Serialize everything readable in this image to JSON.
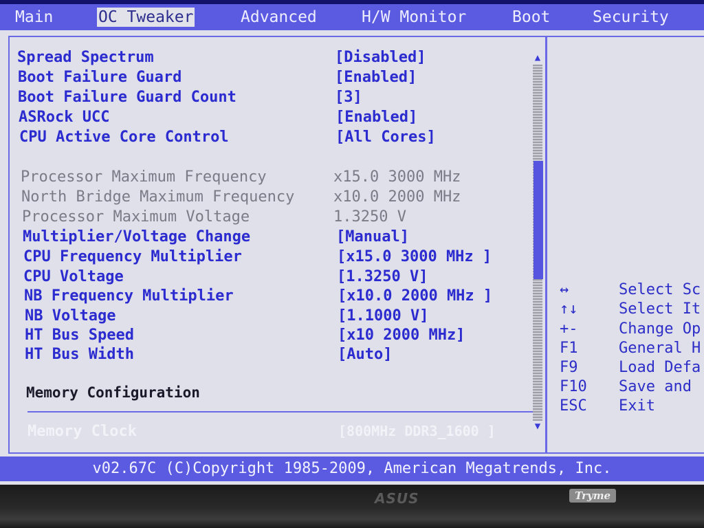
{
  "menu": {
    "tabs": [
      {
        "label": "Main",
        "active": false
      },
      {
        "label": "OC Tweaker",
        "active": true
      },
      {
        "label": "Advanced",
        "active": false
      },
      {
        "label": "H/W Monitor",
        "active": false
      },
      {
        "label": "Boot",
        "active": false
      },
      {
        "label": "Security",
        "active": false
      }
    ]
  },
  "settings": [
    {
      "label": "Spread Spectrum",
      "value": "[Disabled]",
      "kind": "setting"
    },
    {
      "label": "Boot Failure Guard",
      "value": "[Enabled]",
      "kind": "setting"
    },
    {
      "label": "Boot Failure Guard Count",
      "value": "[3]",
      "kind": "setting"
    },
    {
      "label": "ASRock UCC",
      "value": "[Enabled]",
      "kind": "setting"
    },
    {
      "label": "CPU Active Core Control",
      "value": "[All Cores]",
      "kind": "setting"
    },
    {
      "label": "Processor Maximum Frequency",
      "value": "x15.0 3000 MHz",
      "kind": "info"
    },
    {
      "label": "North Bridge Maximum Frequency",
      "value": "x10.0 2000 MHz",
      "kind": "info"
    },
    {
      "label": "Processor Maximum Voltage",
      "value": "1.3250 V",
      "kind": "info"
    },
    {
      "label": "Multiplier/Voltage Change",
      "value": "[Manual]",
      "kind": "setting"
    },
    {
      "label": "CPU Frequency Multiplier",
      "value": "[x15.0 3000 MHz ]",
      "kind": "setting"
    },
    {
      "label": "CPU Voltage",
      "value": "[1.3250 V]",
      "kind": "setting"
    },
    {
      "label": "NB Frequency Multiplier",
      "value": "[x10.0 2000 MHz ]",
      "kind": "setting"
    },
    {
      "label": "NB Voltage",
      "value": "[1.1000 V]",
      "kind": "setting"
    },
    {
      "label": "HT Bus Speed",
      "value": "[x10 2000 MHz]",
      "kind": "setting"
    },
    {
      "label": "HT Bus Width",
      "value": "[Auto]",
      "kind": "setting"
    },
    {
      "label": "Memory Configuration",
      "value": "",
      "kind": "section"
    },
    {
      "label": "Memory Clock",
      "value": "[800MHz DDR3_1600 ]",
      "kind": "dim"
    }
  ],
  "help": [
    {
      "key": "↔",
      "desc": "Select Sc"
    },
    {
      "key": "↑↓",
      "desc": "Select It"
    },
    {
      "key": "+-",
      "desc": "Change Op"
    },
    {
      "key": "F1",
      "desc": "General H"
    },
    {
      "key": "F9",
      "desc": "Load Defa"
    },
    {
      "key": "F10",
      "desc": "Save and"
    },
    {
      "key": "ESC",
      "desc": "Exit"
    }
  ],
  "scroll": {
    "up_glyph": "▲",
    "down_glyph": "▼"
  },
  "footer": {
    "copyright": "v02.67C (C)Copyright 1985-2009, American Megatrends, Inc."
  },
  "bezel": {
    "brand": "ASUS",
    "badge": "Tryme"
  }
}
